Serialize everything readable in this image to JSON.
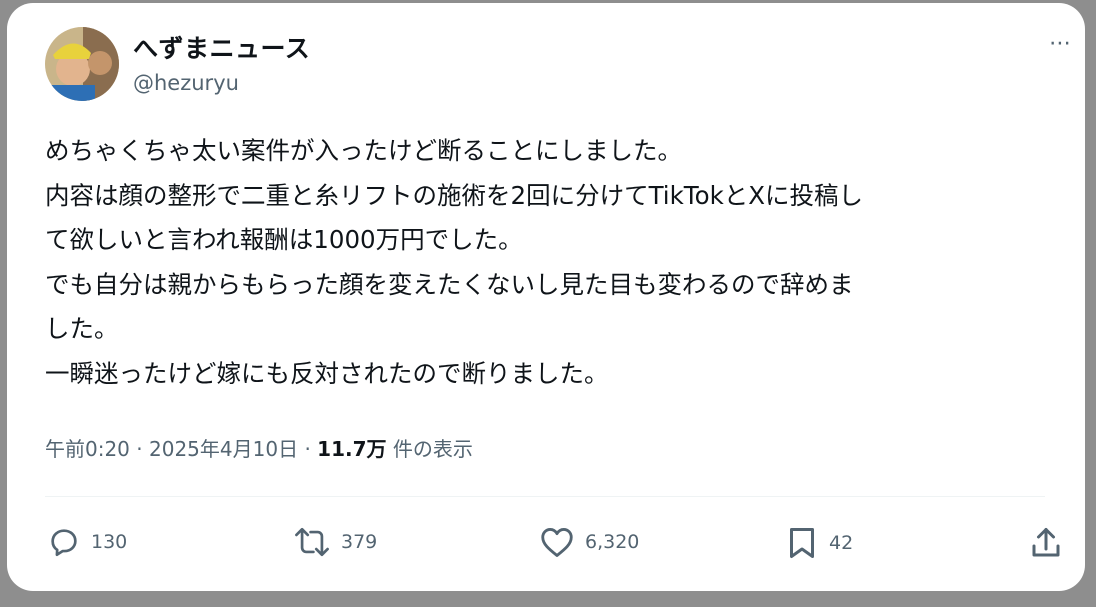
{
  "post": {
    "display_name": "へずまニュース",
    "handle": "@hezuryu",
    "more_icon": "⋯",
    "text": "めちゃくちゃ太い案件が入ったけど断ることにしました。\n内容は顔の整形で二重と糸リフトの施術を2回に分けてTikTokとXに投稿し\nて欲しいと言われ報酬は1000万円でした。\nでも自分は親からもらった顔を変えたくないし見た目も変わるので辞めま\nした。\n一瞬迷ったけど嫁にも反対されたので断りました。",
    "time": "午前0:20",
    "date": "2025年4月10日",
    "separator": "·",
    "views_count": "11.7万",
    "views_label": "件の表示"
  },
  "actions": {
    "reply": {
      "icon": "reply-icon",
      "count": "130"
    },
    "repost": {
      "icon": "repost-icon",
      "count": "379"
    },
    "like": {
      "icon": "heart-icon",
      "count": "6,320"
    },
    "bookmark": {
      "icon": "bookmark-icon",
      "count": "42"
    },
    "share": {
      "icon": "share-icon"
    }
  },
  "colors": {
    "text": "#0f1419",
    "secondary": "#536471",
    "background": "#ffffff"
  }
}
